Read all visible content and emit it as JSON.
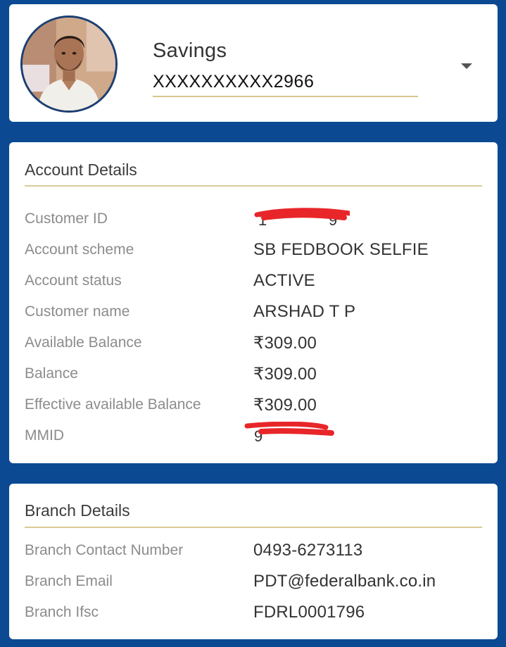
{
  "account_selector": {
    "type": "Savings",
    "number": "XXXXXXXXXX2966",
    "dropdown_icon": "caret-down"
  },
  "account_details": {
    "title": "Account Details",
    "rows": [
      {
        "label": "Customer ID",
        "value": "",
        "redacted": true
      },
      {
        "label": "Account scheme",
        "value": "SB FEDBOOK SELFIE"
      },
      {
        "label": "Account status",
        "value": "ACTIVE"
      },
      {
        "label": "Customer name",
        "value": "ARSHAD T P"
      },
      {
        "label": "Available Balance",
        "value": "₹309.00"
      },
      {
        "label": "Balance",
        "value": "₹309.00"
      },
      {
        "label": "Effective available Balance",
        "value": "₹309.00"
      },
      {
        "label": "MMID",
        "value": "",
        "redacted": true
      }
    ]
  },
  "branch_details": {
    "title": "Branch Details",
    "rows": [
      {
        "label": "Branch Contact Number",
        "value": "0493-6273113"
      },
      {
        "label": "Branch Email",
        "value": "PDT@federalbank.co.in"
      },
      {
        "label": "Branch Ifsc",
        "value": "FDRL0001796"
      }
    ]
  },
  "colors": {
    "background": "#0b4a93",
    "card": "#ffffff",
    "divider": "#d8cb95",
    "redaction": "#e8262a",
    "avatar_border": "#1b3f72"
  }
}
